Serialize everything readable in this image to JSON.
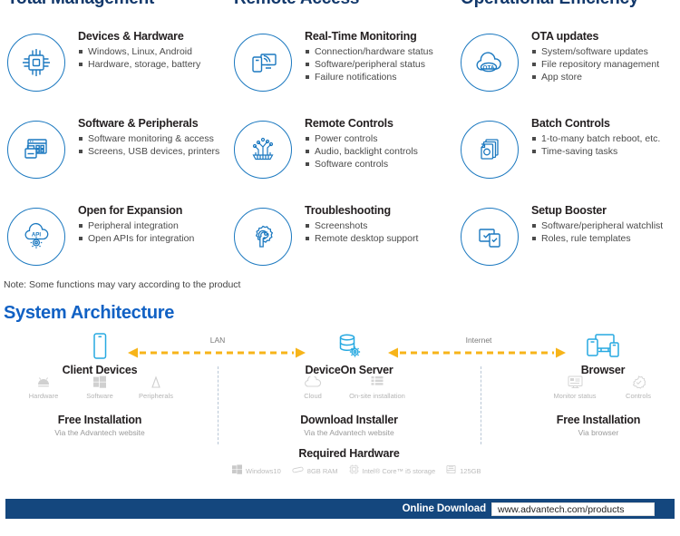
{
  "features": {
    "columns": [
      {
        "title": "Total Management"
      },
      {
        "title": "Remote Access"
      },
      {
        "title": "Operational Efficiency"
      }
    ],
    "items": [
      {
        "icon": "chip-icon",
        "title": "Devices & Hardware",
        "bullets": [
          "Windows, Linux, Android",
          "Hardware, storage, battery"
        ]
      },
      {
        "icon": "real-time-monitoring-icon",
        "title": "Real-Time Monitoring",
        "bullets": [
          "Connection/hardware status",
          "Software/peripheral status",
          "Failure notifications"
        ]
      },
      {
        "icon": "ota-cloud-icon",
        "title": "OTA updates",
        "bullets": [
          "System/software updates",
          "File repository management",
          "App store"
        ]
      },
      {
        "icon": "software-peripherals-icon",
        "title": "Software & Peripherals",
        "bullets": [
          "Software monitoring & access",
          "Screens, USB devices, printers"
        ]
      },
      {
        "icon": "circuit-controls-icon",
        "title": "Remote Controls",
        "bullets": [
          "Power controls",
          "Audio, backlight controls",
          "Software controls"
        ]
      },
      {
        "icon": "batch-documents-icon",
        "title": "Batch Controls",
        "bullets": [
          "1-to-many batch reboot, etc.",
          "Time-saving tasks"
        ]
      },
      {
        "icon": "api-cloud-gear-icon",
        "title": "Open for Expansion",
        "bullets": [
          "Peripheral integration",
          "Open APIs for integration"
        ]
      },
      {
        "icon": "gear-wrench-icon",
        "title": "Troubleshooting",
        "bullets": [
          "Screenshots",
          "Remote desktop support"
        ]
      },
      {
        "icon": "devices-check-icon",
        "title": "Setup Booster",
        "bullets": [
          "Software/peripheral watchlist",
          "Roles, rule templates"
        ]
      }
    ],
    "note": "Note: Some functions may vary according to the product"
  },
  "architecture": {
    "title": "System Architecture",
    "nodes": [
      {
        "icon": "smartphone-icon",
        "label": "Client Devices"
      },
      {
        "icon": "database-gear-icon",
        "label": "DeviceOn Server"
      },
      {
        "icon": "multi-device-browser-icon",
        "label": "Browser"
      }
    ],
    "links": [
      {
        "label": "LAN"
      },
      {
        "label": "Internet"
      }
    ],
    "client_sub": [
      {
        "icon": "android-icon",
        "label": "Hardware"
      },
      {
        "icon": "windows-icon",
        "label": "Software"
      },
      {
        "icon": "peripheral-icon",
        "label": "Peripherals"
      }
    ],
    "server_sub": [
      {
        "icon": "cloud-icon",
        "label": "Cloud"
      },
      {
        "icon": "onsite-install-icon",
        "label": "On-site installation"
      }
    ],
    "browser_sub": [
      {
        "icon": "monitor-status-icon",
        "label": "Monitor status"
      },
      {
        "icon": "controls-gear-icon",
        "label": "Controls"
      }
    ],
    "blocks": [
      {
        "head": "Free Installation",
        "sub": "Via the Advantech website"
      },
      {
        "head": "Download Installer",
        "sub": "Via the Advantech website"
      },
      {
        "head": "Free Installation",
        "sub": "Via browser"
      }
    ],
    "required_hardware": {
      "head": "Required Hardware",
      "items": [
        {
          "icon": "windows-icon",
          "label": "Windows10"
        },
        {
          "icon": "ram-icon",
          "label": "8GB RAM"
        },
        {
          "icon": "cpu-icon",
          "label": "Intel® Core™ i5 storage"
        },
        {
          "icon": "storage-icon",
          "label": "125GB"
        }
      ]
    }
  },
  "footer": {
    "download_label": "Online Download",
    "url": "www.advantech.com/products"
  },
  "colors": {
    "brand_blue": "#1c79c0",
    "heading_navy": "#12386b",
    "arch_title_blue": "#1161c4",
    "footer_navy": "#14477e",
    "arrow_amber": "#f7b419"
  }
}
